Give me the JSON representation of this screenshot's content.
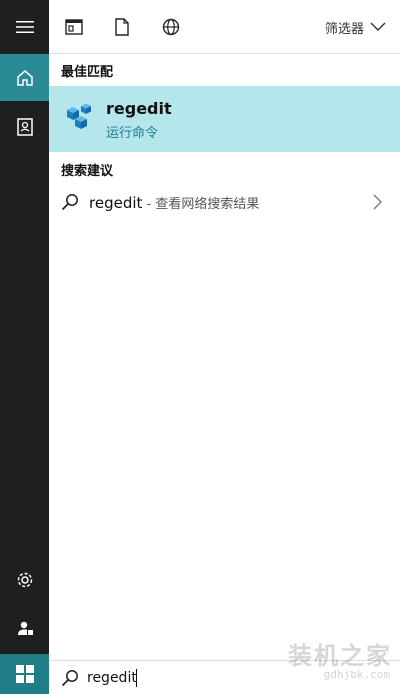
{
  "rail": {
    "items": [
      {
        "name": "hamburger-menu-icon"
      },
      {
        "name": "home-icon",
        "active": true
      },
      {
        "name": "notebook-icon"
      },
      {
        "name": "settings-icon"
      },
      {
        "name": "feedback-icon"
      },
      {
        "name": "windows-start-icon"
      }
    ]
  },
  "toolbar": {
    "icons": [
      "apps-icon",
      "documents-icon",
      "web-icon"
    ],
    "filter_label": "筛选器"
  },
  "results": {
    "best_match_header": "最佳匹配",
    "best_match": {
      "title": "regedit",
      "subtitle": "运行命令",
      "icon": "registry-editor-icon"
    },
    "suggestions_header": "搜索建议",
    "suggestion": {
      "term": "regedit",
      "description": " - 查看网络搜索结果"
    }
  },
  "searchbox": {
    "value": "regedit"
  },
  "watermark": {
    "title": "装机之家",
    "url": "gdhjbk.com"
  },
  "colors": {
    "rail_bg": "#1f1f1f",
    "accent": "#2b8b94",
    "best_match_bg": "#b4e6eb",
    "subtitle": "#1b7f8e"
  }
}
